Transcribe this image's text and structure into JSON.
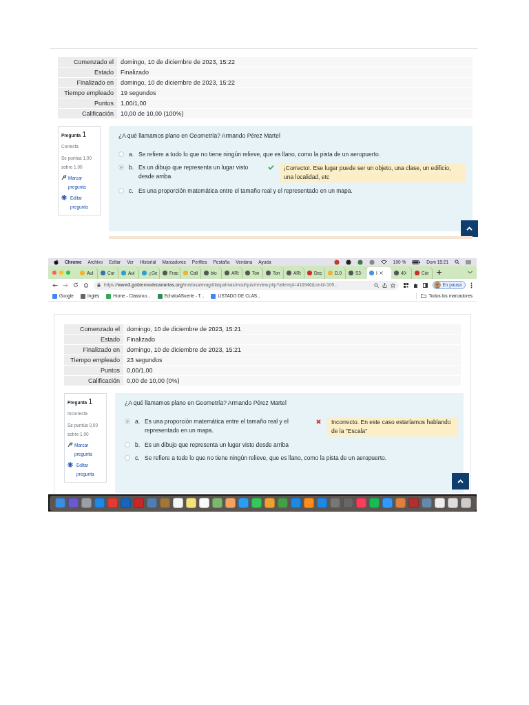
{
  "review_1": {
    "summary": [
      {
        "label": "Comenzado el",
        "value": "domingo, 10 de diciembre de 2023, 15:22"
      },
      {
        "label": "Estado",
        "value": "Finalizado"
      },
      {
        "label": "Finalizado en",
        "value": "domingo, 10 de diciembre de 2023, 15:22"
      },
      {
        "label": "Tiempo empleado",
        "value": "19 segundos"
      },
      {
        "label": "Puntos",
        "value": "1,00/1,00"
      },
      {
        "label": "Calificación",
        "value": "10,00 de 10,00 (100%)"
      }
    ],
    "question": {
      "title": "Pregunta",
      "number": "1",
      "status": "Correcta",
      "score": "Se puntúa 1,00 sobre 1,00",
      "flag_link": "Marcar pregunta",
      "edit_link": "Editar pregunta",
      "text": "¿A qué llamamos plano en Geometría? Armando Pérez Martel",
      "options": [
        {
          "letter": "a.",
          "text": "Se refiere a todo lo que no tiene ningún relieve, que es llano, como la pista de un aeropuerto.",
          "selected": false
        },
        {
          "letter": "b.",
          "text": "Es un dibujo que representa un lugar visto desde arriba",
          "selected": true,
          "correct": true,
          "feedback": "¡Correcto!. Ese lugar puede ser un objeto, una clase, un edificio, una localidad, etc"
        },
        {
          "letter": "c.",
          "text": "Es una proporción matemática entre el tamaño real y el representado en un mapa.",
          "selected": false
        }
      ]
    }
  },
  "menu_bar": {
    "app": "Chrome",
    "items": [
      "Archivo",
      "Editar",
      "Ver",
      "Historial",
      "Marcadores",
      "Perfiles",
      "Pestaña",
      "Ventana",
      "Ayuda"
    ],
    "battery": "100 %",
    "clock": "Dom 15:21"
  },
  "tabs": [
    {
      "label": "Aul",
      "color": "#f2b233",
      "selected": false
    },
    {
      "label": "Cur",
      "color": "#3a6fb0",
      "selected": false
    },
    {
      "label": "Aul",
      "color": "#2a9fd6",
      "selected": false
    },
    {
      "label": "¿Ge",
      "color": "#2a9fd6",
      "selected": false
    },
    {
      "label": "Frac",
      "color": "#555555",
      "selected": false
    },
    {
      "label": "Cali",
      "color": "#f2b233",
      "selected": false
    },
    {
      "label": "blo",
      "color": "#555555",
      "selected": false
    },
    {
      "label": "ARt",
      "color": "#555555",
      "selected": false
    },
    {
      "label": "Ton",
      "color": "#555555",
      "selected": false
    },
    {
      "label": "Ton",
      "color": "#555555",
      "selected": false
    },
    {
      "label": "ARt",
      "color": "#555555",
      "selected": false
    },
    {
      "label": "Dec",
      "color": "#d62828",
      "selected": false
    },
    {
      "label": "D.0",
      "color": "#f2b233",
      "selected": false
    },
    {
      "label": "S3·",
      "color": "#555555",
      "selected": false
    },
    {
      "label": "I",
      "color": "#4a8fe0",
      "selected": true
    },
    {
      "label": "40·",
      "color": "#555555",
      "selected": false
    },
    {
      "label": "Cór",
      "color": "#d62828",
      "selected": false
    }
  ],
  "address_bar": {
    "url": "https://**www3.gobiernodecanarias.org**/medusa/evagd/laspalmas/mod/quiz/review.php?attempt=416946&cmid=109...",
    "profile": "En pausa"
  },
  "bookmarks": [
    {
      "label": "Google",
      "color": "#4285f4"
    },
    {
      "label": "Inglés",
      "color": "#666666"
    },
    {
      "label": "Home - Classroo...",
      "color": "#34a853"
    },
    {
      "label": "EchaloASuerte - T...",
      "color": "#2e8b57"
    },
    {
      "label": "LISTADO DE CLAS...",
      "color": "#4285f4"
    }
  ],
  "all_bookmarks": "Todos los marcadores",
  "review_2": {
    "summary": [
      {
        "label": "Comenzado el",
        "value": "domingo, 10 de diciembre de 2023, 15:21"
      },
      {
        "label": "Estado",
        "value": "Finalizado"
      },
      {
        "label": "Finalizado en",
        "value": "domingo, 10 de diciembre de 2023, 15:21"
      },
      {
        "label": "Tiempo empleado",
        "value": "23 segundos"
      },
      {
        "label": "Puntos",
        "value": "0,00/1,00"
      },
      {
        "label": "Calificación",
        "value": "0,00 de 10,00 (0%)"
      }
    ],
    "question": {
      "title": "Pregunta",
      "number": "1",
      "status": "Incorrecta",
      "score": "Se puntúa 0,00 sobre 1,00",
      "flag_link": "Marcar pregunta",
      "edit_link": "Editar pregunta",
      "text": "¿A qué llamamos plano en Geometría? Armando Pérez Martel",
      "options": [
        {
          "letter": "a.",
          "text": "Es una proporción matemática entre el tamaño real y el representado en un mapa.",
          "selected": true,
          "correct": false,
          "feedback": "Incorrecto. En este caso estaríamos hablando de la \"Escala\""
        },
        {
          "letter": "b.",
          "text": "Es un dibujo que representa un lugar visto desde arriba",
          "selected": false
        },
        {
          "letter": "c.",
          "text": "Se refiere a todo lo que no tiene ningún relieve, que es llano, como la pista de un aeropuerto.",
          "selected": false
        }
      ]
    }
  },
  "dock": [
    {
      "color": "#3b8de0"
    },
    {
      "color": "#6a5acd"
    },
    {
      "color": "#9aa0a6"
    },
    {
      "color": "#1e88e5"
    },
    {
      "color": "#e53935"
    },
    {
      "color": "#1565c0"
    },
    {
      "color": "#c62828"
    },
    {
      "color": "#4f7fb0"
    },
    {
      "color": "#a0773a"
    },
    {
      "color": "#f5f5f5"
    },
    {
      "color": "#f7e27a"
    },
    {
      "color": "#fafafa"
    },
    {
      "color": "#7cb86c"
    },
    {
      "color": "#f4a261"
    },
    {
      "color": "#2e9df0"
    },
    {
      "color": "#34c759"
    },
    {
      "color": "#f0a030"
    },
    {
      "color": "#43a047"
    },
    {
      "color": "#1e88e5"
    },
    {
      "color": "#ff8c1a"
    },
    {
      "color": "#1e88e5"
    },
    {
      "color": "#777777"
    },
    {
      "color": "#666666"
    },
    {
      "color": "#fa3e5a"
    },
    {
      "color": "#1db954"
    },
    {
      "color": "#3399ff"
    },
    {
      "color": "#e08040"
    },
    {
      "color": "#b03030"
    },
    {
      "color": "#6688aa"
    },
    {
      "color": "#eeeeee"
    },
    {
      "color": "#dddddd"
    },
    {
      "color": "#cccccc"
    }
  ]
}
